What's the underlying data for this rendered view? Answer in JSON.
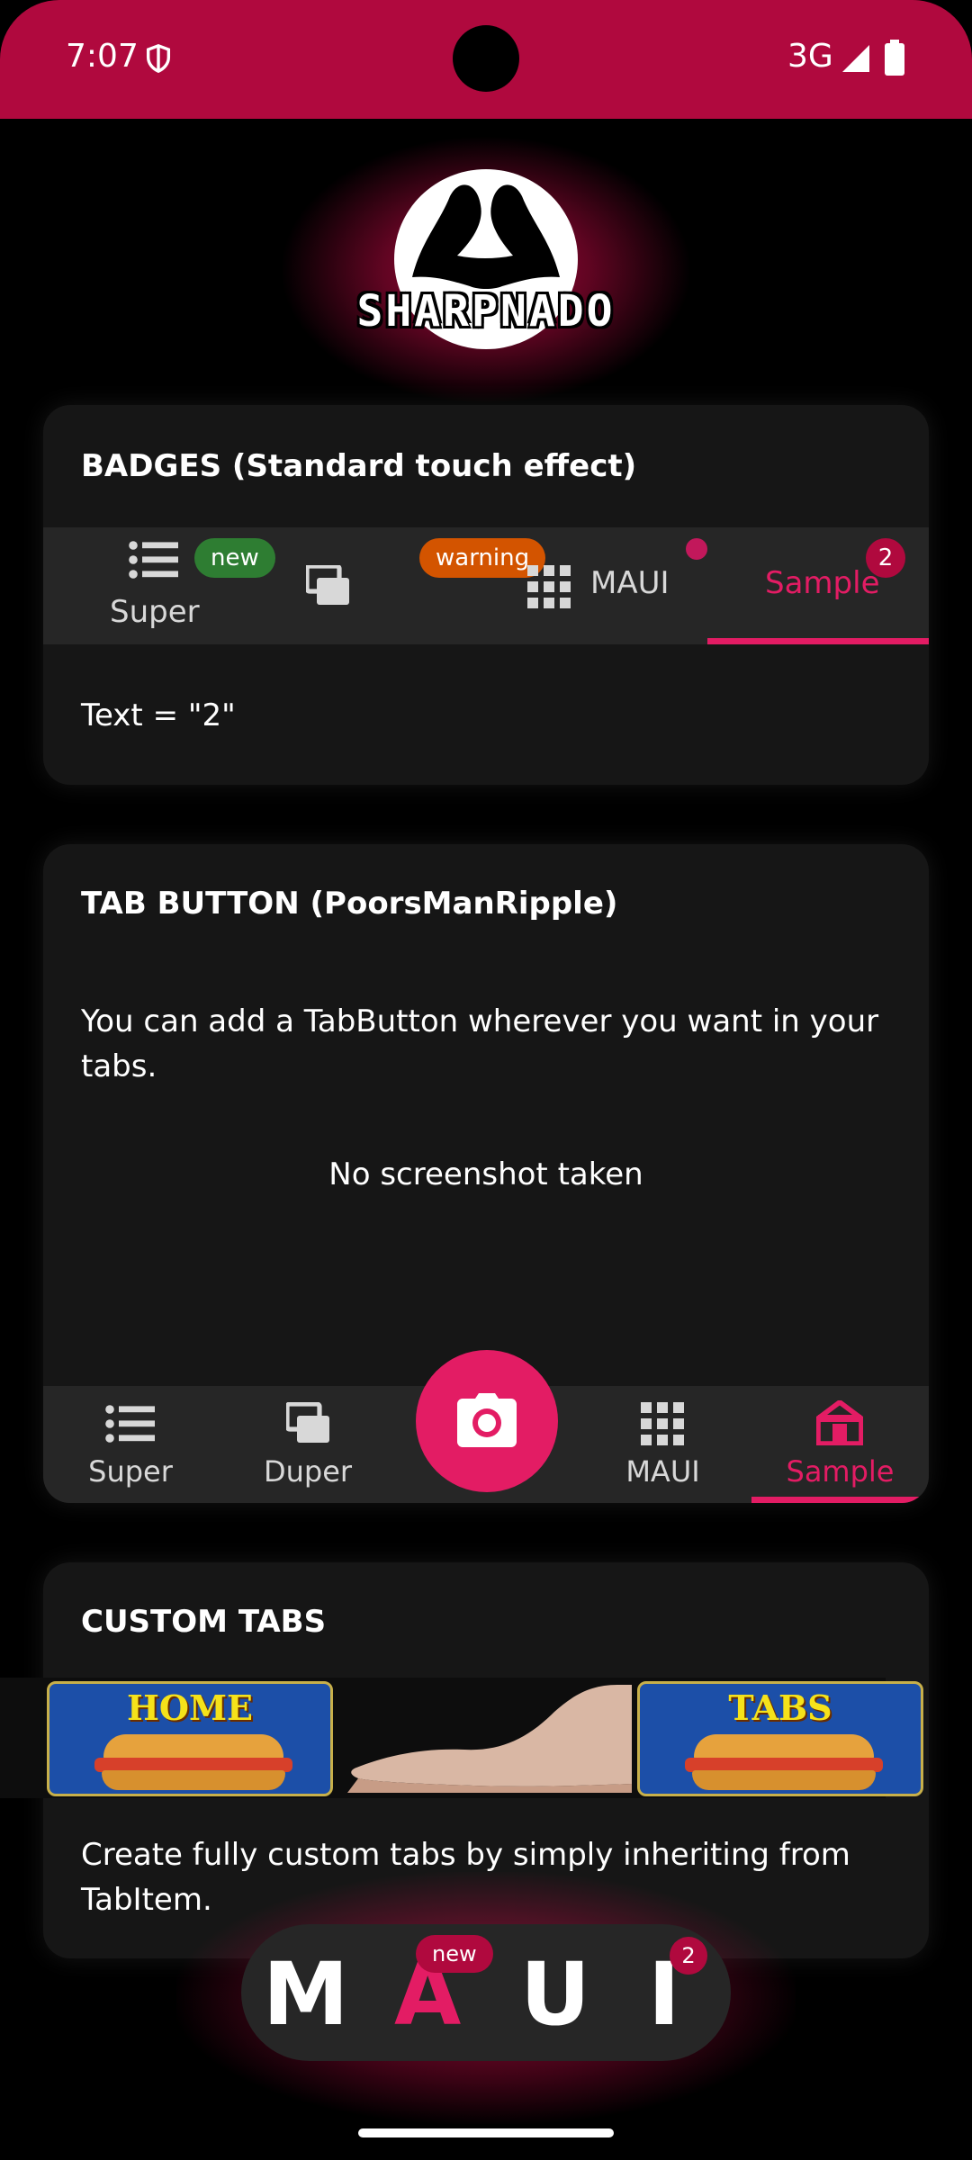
{
  "status_bar": {
    "time": "7:07",
    "network": "3G",
    "bg_color": "#B0093E"
  },
  "logo": {
    "text": "SHARPNADO"
  },
  "badges_card": {
    "title": "BADGES (Standard touch effect)",
    "tabs": [
      {
        "label": "Super",
        "icon": "list-icon",
        "badge": "new",
        "badge_color": "#2E7D32"
      },
      {
        "label": "",
        "icon": "stack-icon",
        "badge": "warning",
        "badge_color": "#D35400"
      },
      {
        "label": "MAUI",
        "icon": "grid-icon",
        "badge": "dot",
        "badge_color": "#C2185B"
      },
      {
        "label": "Sample",
        "icon": "",
        "badge": "2",
        "badge_color": "#B0093E",
        "selected": true
      }
    ],
    "body_text": "Text = \"2\""
  },
  "tab_button_card": {
    "title": "TAB BUTTON (PoorsManRipple)",
    "description": "You can add a TabButton wherever you want in your tabs.",
    "status": "No screenshot taken",
    "tabs": [
      {
        "label": "Super",
        "icon": "list-icon"
      },
      {
        "label": "Duper",
        "icon": "stack-icon"
      },
      {
        "label": "",
        "icon": "camera-icon",
        "is_button": true
      },
      {
        "label": "MAUI",
        "icon": "grid-icon"
      },
      {
        "label": "Sample",
        "icon": "house-icon",
        "selected": true
      }
    ]
  },
  "custom_tabs_card": {
    "title": "CUSTOM TABS",
    "tabs": [
      {
        "label": "HOME"
      },
      {
        "label": ""
      },
      {
        "label": "TABS"
      }
    ],
    "description": "Create fully custom tabs by simply inheriting from TabItem."
  },
  "maui_bar": {
    "letters": [
      "M",
      "A",
      "U",
      "I"
    ],
    "badges": [
      {
        "letter_index": 1,
        "text": "new"
      },
      {
        "letter_index": 3,
        "text": "2"
      }
    ],
    "accent_color": "#E31C64"
  }
}
